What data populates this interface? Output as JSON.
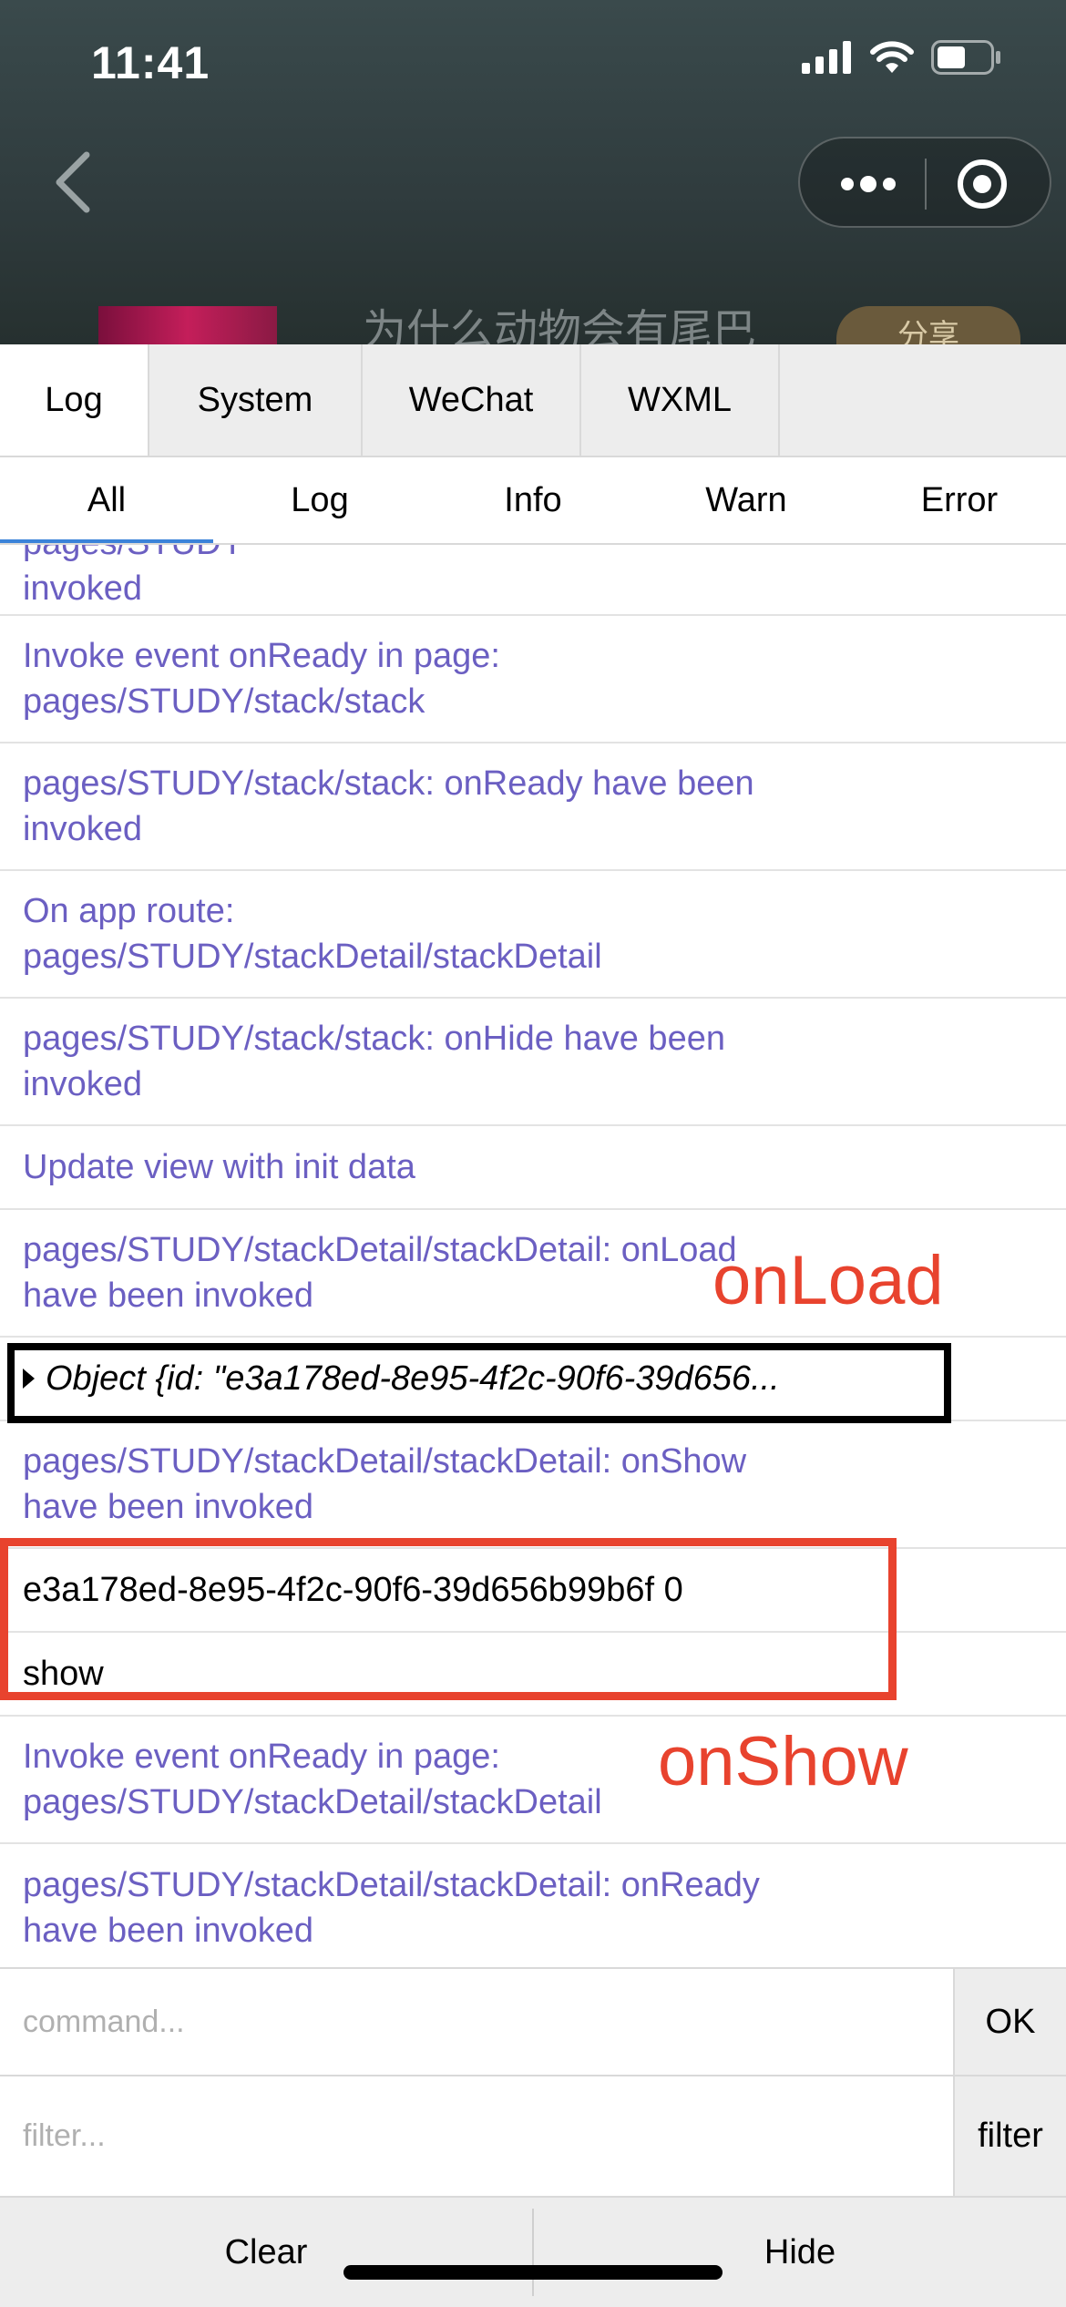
{
  "status_bar": {
    "time": "11:41"
  },
  "page_header": {
    "title": "为什么动物会有尾巴",
    "share_label": "分享"
  },
  "console": {
    "tabs": [
      {
        "label": "Log",
        "active": true
      },
      {
        "label": "System",
        "active": false
      },
      {
        "label": "WeChat",
        "active": false
      },
      {
        "label": "WXML",
        "active": false
      }
    ],
    "subtabs": [
      {
        "label": "All",
        "active": true
      },
      {
        "label": "Log",
        "active": false
      },
      {
        "label": "Info",
        "active": false
      },
      {
        "label": "Warn",
        "active": false
      },
      {
        "label": "Error",
        "active": false
      }
    ],
    "logs": [
      {
        "lines": [
          "invoked"
        ],
        "type": "info"
      },
      {
        "lines": [
          "Invoke event onReady in page:",
          "pages/STUDY/stack/stack"
        ],
        "type": "info"
      },
      {
        "lines": [
          "pages/STUDY/stack/stack: onReady have been",
          "invoked"
        ],
        "type": "info"
      },
      {
        "lines": [
          "On app route:",
          "pages/STUDY/stackDetail/stackDetail"
        ],
        "type": "info"
      },
      {
        "lines": [
          "pages/STUDY/stack/stack: onHide have been",
          "invoked"
        ],
        "type": "info"
      },
      {
        "lines": [
          "Update view with init data"
        ],
        "type": "info"
      },
      {
        "lines": [
          "pages/STUDY/stackDetail/stackDetail: onLoad",
          "have been invoked"
        ],
        "type": "info"
      },
      {
        "lines": [
          "Object {id: \"e3a178ed-8e95-4f2c-90f6-39d656..."
        ],
        "type": "object"
      },
      {
        "lines": [
          "pages/STUDY/stackDetail/stackDetail: onShow",
          "have been invoked"
        ],
        "type": "info"
      },
      {
        "lines": [
          "e3a178ed-8e95-4f2c-90f6-39d656b99b6f 0"
        ],
        "type": "log"
      },
      {
        "lines": [
          "show"
        ],
        "type": "log"
      },
      {
        "lines": [
          "Invoke event onReady in page:",
          "pages/STUDY/stackDetail/stackDetail"
        ],
        "type": "info"
      },
      {
        "lines": [
          "pages/STUDY/stackDetail/stackDetail: onReady",
          "have been invoked"
        ],
        "type": "info"
      }
    ],
    "annotations": {
      "onload": "onLoad",
      "onshow": "onShow"
    },
    "command": {
      "placeholder": "command...",
      "button": "OK"
    },
    "filter": {
      "placeholder": "filter...",
      "button": "filter"
    },
    "bottom": {
      "clear": "Clear",
      "hide": "Hide"
    }
  },
  "colors": {
    "log_text": "#6b5fc2",
    "annotation": "#e8432e",
    "active_tab_underline": "#3b83d9"
  }
}
